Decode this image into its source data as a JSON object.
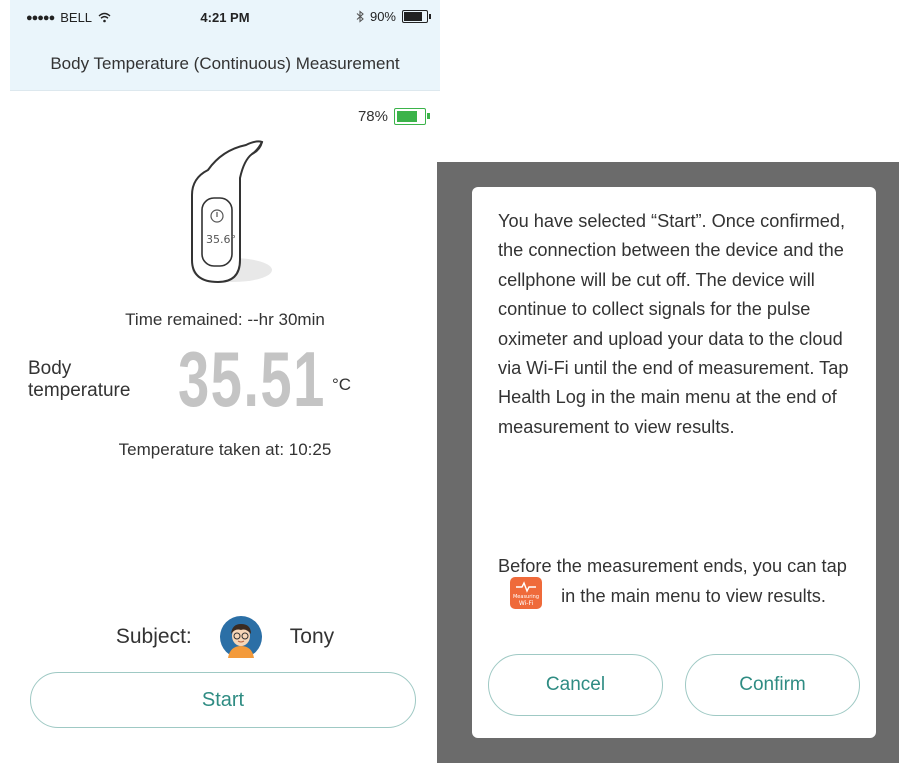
{
  "status_bar": {
    "signal_dots": "●●●●●",
    "carrier": "BELL",
    "time": "4:21 PM",
    "battery_percent": "90%",
    "battery_level": 0.9,
    "icons": [
      "signal-dots-icon",
      "wifi-icon",
      "bluetooth-icon",
      "battery-icon"
    ]
  },
  "header": {
    "title": "Body Temperature (Continuous) Measurement"
  },
  "device": {
    "battery_text": "78%",
    "battery_level": 0.78,
    "battery_color": "#3bb34a",
    "screen_reading": "35.6°"
  },
  "measurement": {
    "time_remaining": "Time remained: --hr 30min",
    "body_label_line1": "Body",
    "body_label_line2": "temperature",
    "value": "35.51",
    "unit": "°C",
    "taken_at": "Temperature taken at: 10:25"
  },
  "subject": {
    "label": "Subject:",
    "name": "Tony"
  },
  "start_button": {
    "label": "Start"
  },
  "dialog": {
    "paragraph1": "You have selected “Start”. Once confirmed, the connection between the device and the cellphone will be cut off. The device will continue to collect signals for the pulse oximeter and upload your data to the cloud via Wi-Fi until the end of measurement. Tap Health Log in the main menu at the end of measurement to view results.",
    "paragraph2_before": "Before the measurement ends, you can tap",
    "paragraph2_after": "in the main menu to view results.",
    "app_icon_text1": "Measuring",
    "app_icon_text2": "Wi-Fi",
    "cancel_label": "Cancel",
    "confirm_label": "Confirm"
  },
  "colors": {
    "header_bg": "#eaf5fb",
    "accent": "#2f8c83",
    "button_border": "#9fc9c4",
    "value_gray": "#c4c4c4",
    "overlay": "#6b6b6b",
    "app_icon": "#ef6a3a"
  }
}
